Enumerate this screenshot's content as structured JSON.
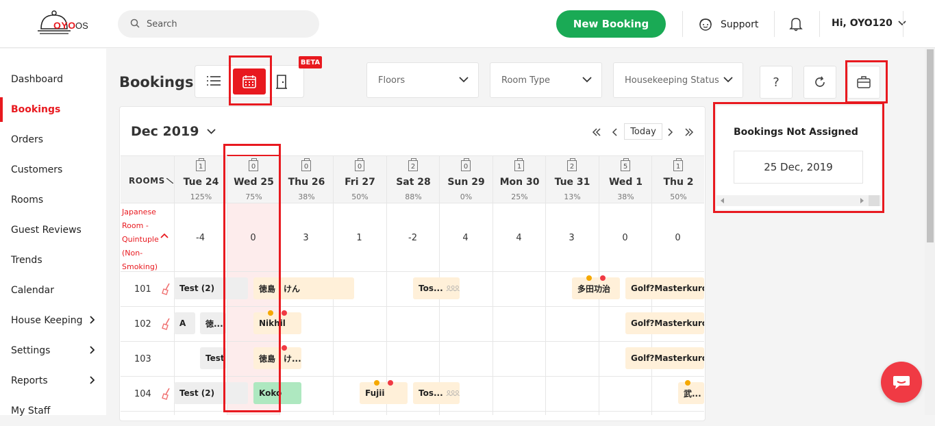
{
  "header": {
    "logo_brand": "OYO",
    "logo_suffix": "OS",
    "search_placeholder": "Search",
    "new_booking_label": "New Booking",
    "support_label": "Support",
    "user_label": "Hi, OYO120"
  },
  "sidebar": {
    "items": [
      {
        "label": "Dashboard",
        "active": false,
        "has_submenu": false
      },
      {
        "label": "Bookings",
        "active": true,
        "has_submenu": false
      },
      {
        "label": "Orders",
        "active": false,
        "has_submenu": false
      },
      {
        "label": "Customers",
        "active": false,
        "has_submenu": false
      },
      {
        "label": "Rooms",
        "active": false,
        "has_submenu": false
      },
      {
        "label": "Guest Reviews",
        "active": false,
        "has_submenu": false
      },
      {
        "label": "Trends",
        "active": false,
        "has_submenu": false
      },
      {
        "label": "Calendar",
        "active": false,
        "has_submenu": false
      },
      {
        "label": "House Keeping",
        "active": false,
        "has_submenu": true
      },
      {
        "label": "Settings",
        "active": false,
        "has_submenu": true
      },
      {
        "label": "Reports",
        "active": false,
        "has_submenu": true
      },
      {
        "label": "My Staff",
        "active": false,
        "has_submenu": false
      }
    ]
  },
  "page": {
    "title": "Bookings",
    "beta_badge": "BETA",
    "filters": {
      "floors": "Floors",
      "room_type": "Room Type",
      "housekeeping": "Housekeeping Status"
    },
    "help_label": "?"
  },
  "calendar": {
    "month_label": "Dec 2019",
    "today_label": "Today",
    "rooms_header": "ROOMS",
    "days": [
      {
        "label": "Tue 24",
        "count": "1",
        "pct": "125%",
        "avail": "-4"
      },
      {
        "label": "Wed 25",
        "count": "0",
        "pct": "75%",
        "avail": "0"
      },
      {
        "label": "Thu 26",
        "count": "0",
        "pct": "38%",
        "avail": "3"
      },
      {
        "label": "Fri 27",
        "count": "0",
        "pct": "50%",
        "avail": "1"
      },
      {
        "label": "Sat 28",
        "count": "2",
        "pct": "88%",
        "avail": "-2"
      },
      {
        "label": "Sun 29",
        "count": "0",
        "pct": "0%",
        "avail": "4"
      },
      {
        "label": "Mon 30",
        "count": "1",
        "pct": "25%",
        "avail": "4"
      },
      {
        "label": "Tue 31",
        "count": "2",
        "pct": "13%",
        "avail": "3"
      },
      {
        "label": "Wed 1",
        "count": "5",
        "pct": "38%",
        "avail": "0"
      },
      {
        "label": "Thu 2",
        "count": "1",
        "pct": "50%",
        "avail": "0"
      }
    ],
    "room_type_label": "Japanese Room - Quintuple (Non-Smoking)",
    "rooms": [
      "101",
      "102",
      "103",
      "104"
    ],
    "bookings": {
      "r101_a": "Test  (2)",
      "r101_b": "徳島　けん",
      "r101_c": "Tos...",
      "r101_d": "多田功治",
      "r101_e": "Golf?Masterkuro ...",
      "r102_a": "A",
      "r102_b": "徳...",
      "r102_c": "Nikhil",
      "r102_d": "Golf?Masterkuro ...",
      "r103_a": "Test",
      "r103_b": "徳島　け...",
      "r103_c": "Golf?Masterkuro ...",
      "r104_a": "Test  (2)",
      "r104_b": "Koko",
      "r104_c": "Fujii",
      "r104_d": "Tos...",
      "r104_e": "武..."
    }
  },
  "unassigned_panel": {
    "title": "Bookings Not Assigned",
    "date": "25 Dec, 2019"
  },
  "colors": {
    "brand_red": "#e8191f",
    "new_booking_green": "#1aaa55",
    "booking_orange": "#fff0d9",
    "booking_green": "#aee8c0"
  }
}
